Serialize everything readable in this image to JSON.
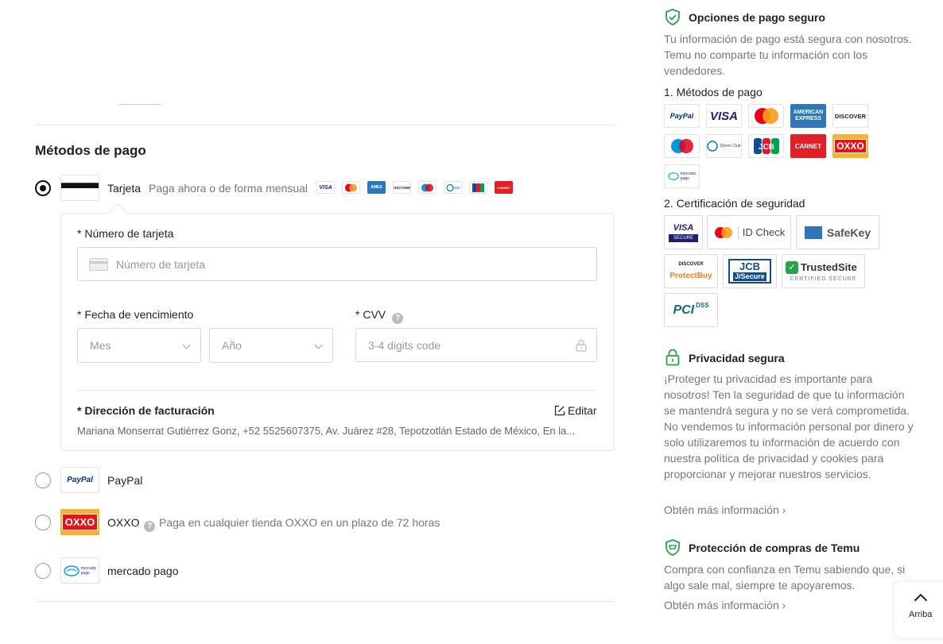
{
  "payment": {
    "section_title": "Métodos de pago",
    "methods": [
      {
        "name": "Tarjeta",
        "description": "Paga ahora o de forma mensual",
        "selected": true
      },
      {
        "name": "PayPal",
        "selected": false
      },
      {
        "name": "OXXO",
        "description": "Paga en cualquier tienda OXXO en un plazo de 72 horas",
        "selected": false
      },
      {
        "name": "mercado pago",
        "selected": false
      }
    ],
    "card_brand_icons": [
      "visa-icon",
      "mastercard-icon",
      "amex-icon",
      "discover-icon",
      "maestro-icon",
      "diners-icon",
      "jcb-icon",
      "carnet-icon"
    ],
    "card_form": {
      "card_number_label": "* Número de tarjeta",
      "card_number_placeholder": "Número de tarjeta",
      "expiry_label": "* Fecha de vencimiento",
      "month_placeholder": "Mes",
      "year_placeholder": "Año",
      "cvv_label": "* CVV",
      "cvv_placeholder": "3-4 digits code",
      "billing_label": "* Dirección de facturación",
      "edit_label": "Editar",
      "billing_address": "Mariana Monserrat Gutiérrez Gonz, +52 5525607375, Av. Juárez #28, Tepotzotlán Estado de México, En la..."
    }
  },
  "logos": {
    "paypal": "PayPal",
    "visa": "VISA",
    "amex_line1": "AMERICAN",
    "amex_line2": "EXPRESS",
    "discover": "DISCOVER",
    "maestro": "maestro",
    "diners": "Diners Club",
    "jcb": "JCB",
    "carnet": "CARNET",
    "oxxo": "OXXO",
    "mercado_line1": "mercado",
    "mercado_line2": "pago",
    "discover_mini": "DISCOVER",
    "amex_mini": "AMEX"
  },
  "sidebar": {
    "secure_title": "Opciones de pago seguro",
    "secure_text": "Tu información de pago está segura con nosotros. Temu no comparte tu información con los vendedores.",
    "methods_title": "1. Métodos de pago",
    "certs_title": "2. Certificación de seguridad",
    "certs": {
      "visa_secure_1": "VISA",
      "visa_secure_2": "SECURE",
      "id_check": "ID Check",
      "safekey": "SafeKey",
      "protectbuy_1": "DISCOVER",
      "protectbuy_2": "ProtectBuy",
      "jcb_secure_1": "JCB",
      "jcb_secure_2": "J/Secure",
      "trustedsite_1": "TrustedSite",
      "trustedsite_2": "CERTIFIED SECURE",
      "pci_1": "PCI",
      "pci_2": "DSS"
    },
    "privacy_title": "Privacidad segura",
    "privacy_text": "¡Proteger tu privacidad es importante para nosotros! Ten la seguridad de que tu información se mantendrá segura y no se verá comprometida. No vendemos tu información personal por dinero y solo utilizaremos tu información de acuerdo con nuestra política de privacidad y cookies para proporcionar y mejorar nuestros servicios.",
    "privacy_link": "Obtén más información ›",
    "protection_title": "Protección de compras de Temu",
    "protection_text": "Compra con confianza en Temu sabiendo que, si algo sale mal, siempre te apoyaremos.",
    "protection_link": "Obtén más información ›"
  },
  "back_to_top": {
    "label": "Arriba"
  },
  "colors": {
    "accent_green": "#2aa24b",
    "text_dark": "#222222",
    "text_muted": "#777777",
    "border": "#e3e3e3"
  }
}
